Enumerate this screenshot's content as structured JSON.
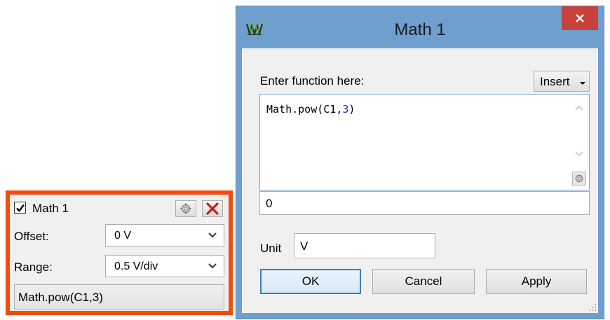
{
  "panel": {
    "title": "Math 1",
    "checked": true,
    "offset_label": "Offset:",
    "offset_value": "0 V",
    "range_label": "Range:",
    "range_value": "0.5 V/div",
    "function_button": "Math.pow(C1,3)",
    "border_color": "#f24c0f",
    "icons": [
      "checkbox-check-icon",
      "gear-icon",
      "close-x-icon",
      "chevron-down-icon"
    ]
  },
  "dialog": {
    "title": "Math 1",
    "enter_label": "Enter function here:",
    "insert_label": "Insert",
    "function_prefix": "Math.pow(C1,",
    "function_number": "3",
    "function_suffix": ")",
    "result_value": "0",
    "unit_label": "Unit",
    "unit_value": "V",
    "ok_label": "OK",
    "cancel_label": "Cancel",
    "apply_label": "Apply",
    "titlebar_color": "#6f9fcf",
    "close_color": "#c9413b",
    "icons": [
      "app-logo-icon",
      "window-close-icon",
      "scroll-up-icon",
      "scroll-down-icon",
      "editor-gear-icon",
      "resize-grip-icon"
    ]
  }
}
